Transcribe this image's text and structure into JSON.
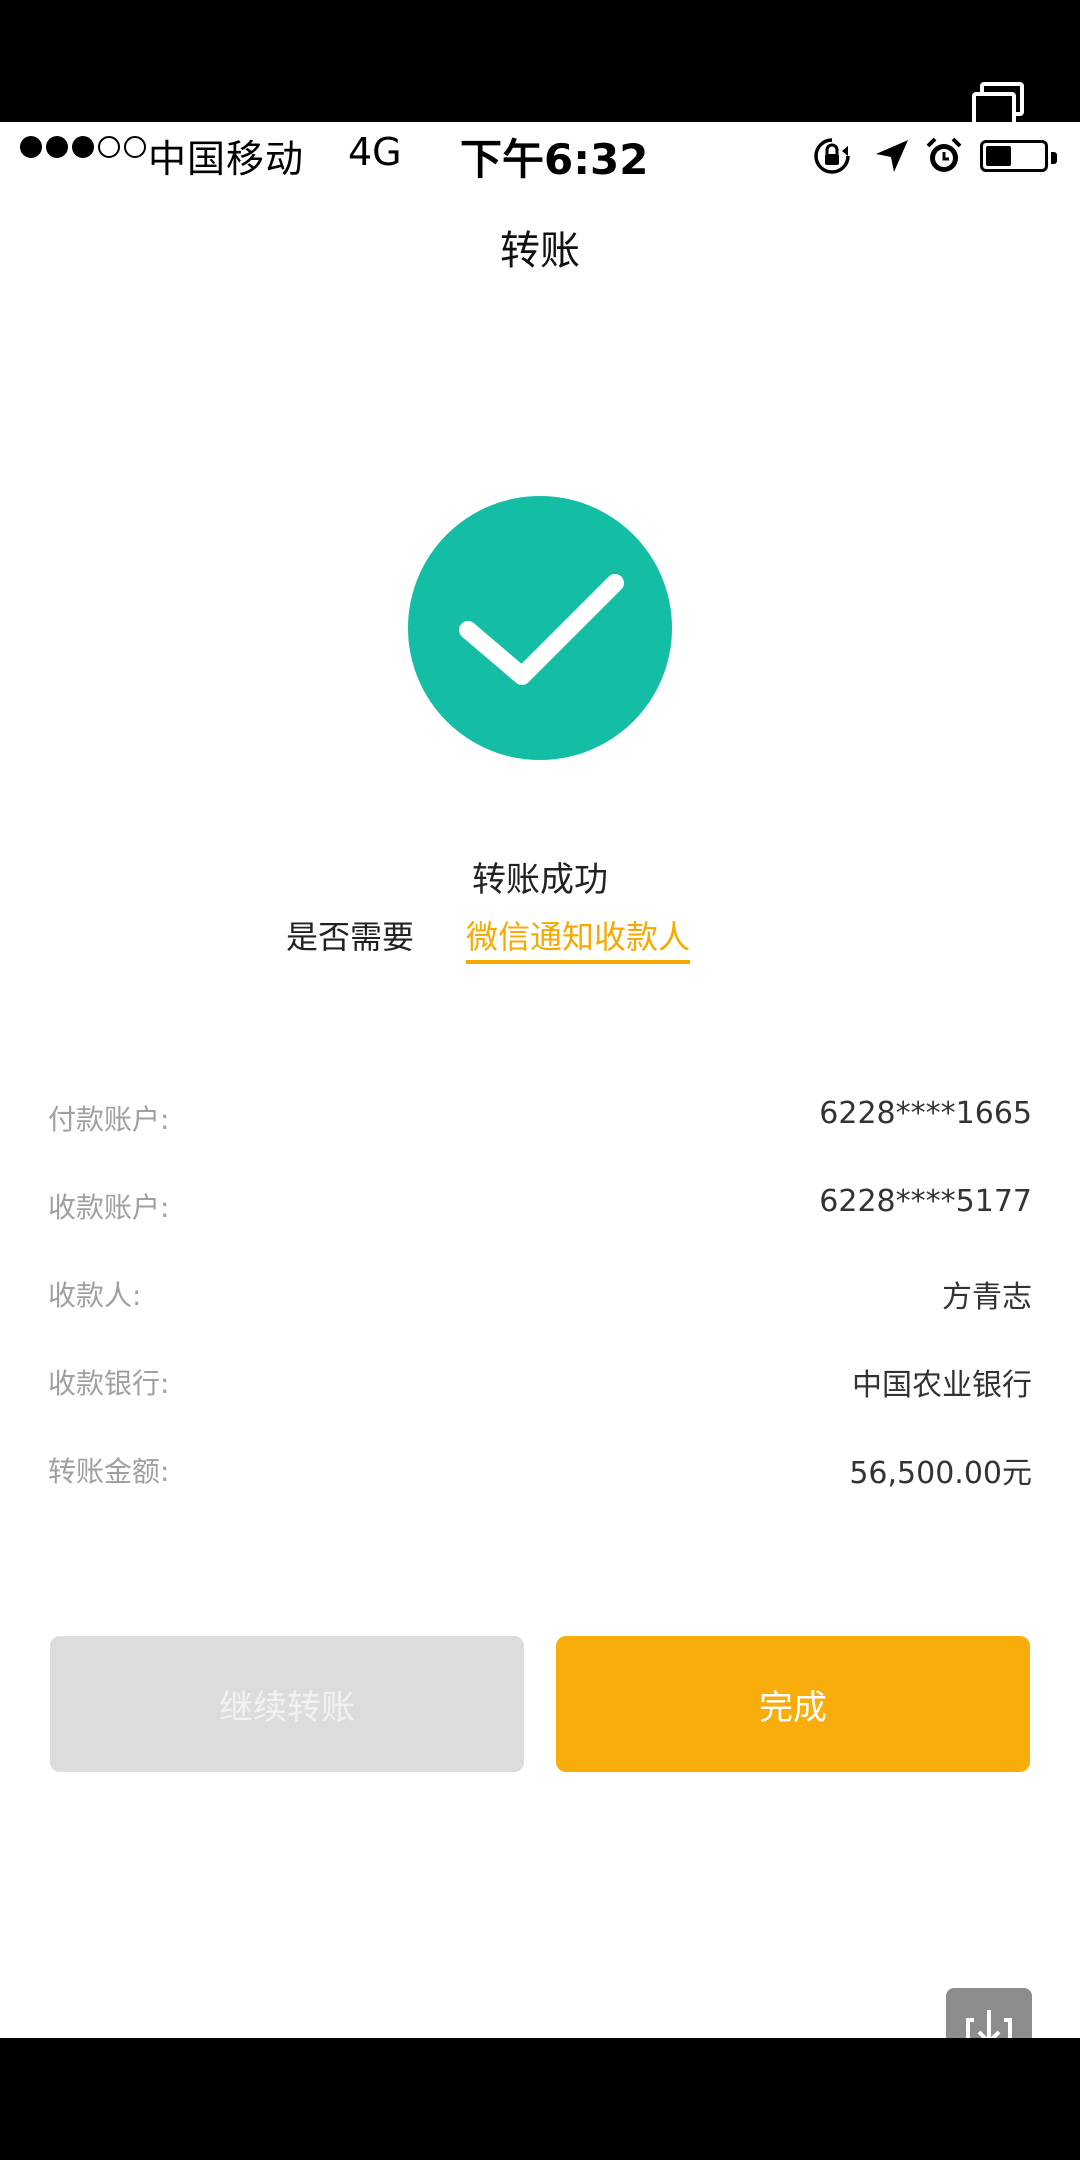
{
  "status_bar": {
    "signal_dots": [
      "filled",
      "filled",
      "filled",
      "empty",
      "empty"
    ],
    "carrier": "中国移动",
    "network": "4G",
    "time": "下午6:32",
    "icons": [
      "orientation-lock-icon",
      "location-arrow-icon",
      "alarm-icon",
      "battery-icon"
    ],
    "battery_level": 0.45
  },
  "nav": {
    "title": "转账"
  },
  "result": {
    "icon": "checkmark-icon",
    "accent_color": "#13bea4",
    "message": "转账成功",
    "notify_prompt": "是否需要",
    "notify_link": "微信通知收款人",
    "link_color": "#f8a900"
  },
  "details": [
    {
      "label": "付款账户:",
      "value": "6228****1665"
    },
    {
      "label": "收款账户:",
      "value": "6228****5177"
    },
    {
      "label": "收款人:",
      "value": "方青志"
    },
    {
      "label": "收款银行:",
      "value": "中国农业银行"
    },
    {
      "label": "转账金额:",
      "value": "56,500.00元"
    }
  ],
  "buttons": {
    "continue_label": "继续转账",
    "done_label": "完成",
    "done_color": "#f8ad0a"
  },
  "overlay": {
    "window_icon": "multi-window-icon",
    "download_icon": "download-icon"
  }
}
